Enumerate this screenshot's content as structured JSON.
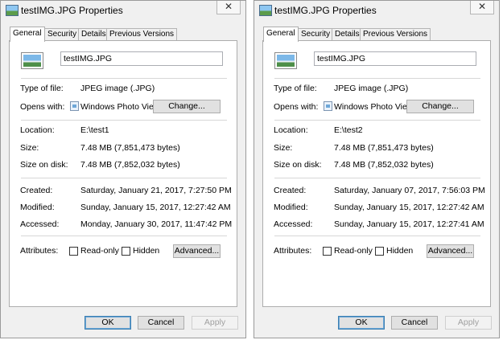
{
  "windows": [
    {
      "title": "testIMG.JPG Properties",
      "close_label": "✕",
      "tabs": [
        "General",
        "Security",
        "Details",
        "Previous Versions"
      ],
      "file_name": "testIMG.JPG",
      "type_label": "Type of file:",
      "type_value": "JPEG image (.JPG)",
      "opens_label": "Opens with:",
      "opens_value": "Windows Photo Viewer",
      "change_label": "Change...",
      "location_label": "Location:",
      "location_value": "E:\\test1",
      "size_label": "Size:",
      "size_value": "7.48 MB (7,851,473 bytes)",
      "disk_label": "Size on disk:",
      "disk_value": "7.48 MB (7,852,032 bytes)",
      "created_label": "Created:",
      "created_value": "Saturday, January 21, 2017, 7:27:50 PM",
      "modified_label": "Modified:",
      "modified_value": "Sunday, January 15, 2017, 12:27:42 AM",
      "accessed_label": "Accessed:",
      "accessed_value": "Monday, January 30, 2017, 11:47:42 PM",
      "attributes_label": "Attributes:",
      "readonly_label": "Read-only",
      "hidden_label": "Hidden",
      "advanced_label": "Advanced...",
      "ok_label": "OK",
      "cancel_label": "Cancel",
      "apply_label": "Apply"
    },
    {
      "title": "testIMG.JPG Properties",
      "close_label": "✕",
      "tabs": [
        "General",
        "Security",
        "Details",
        "Previous Versions"
      ],
      "file_name": "testIMG.JPG",
      "type_label": "Type of file:",
      "type_value": "JPEG image (.JPG)",
      "opens_label": "Opens with:",
      "opens_value": "Windows Photo Viewer",
      "change_label": "Change...",
      "location_label": "Location:",
      "location_value": "E:\\test2",
      "size_label": "Size:",
      "size_value": "7.48 MB (7,851,473 bytes)",
      "disk_label": "Size on disk:",
      "disk_value": "7.48 MB (7,852,032 bytes)",
      "created_label": "Created:",
      "created_value": "Saturday, January 07, 2017, 7:56:03 PM",
      "modified_label": "Modified:",
      "modified_value": "Sunday, January 15, 2017, 12:27:42 AM",
      "accessed_label": "Accessed:",
      "accessed_value": "Sunday, January 15, 2017, 12:27:41 AM",
      "attributes_label": "Attributes:",
      "readonly_label": "Read-only",
      "hidden_label": "Hidden",
      "advanced_label": "Advanced...",
      "ok_label": "OK",
      "cancel_label": "Cancel",
      "apply_label": "Apply"
    }
  ]
}
